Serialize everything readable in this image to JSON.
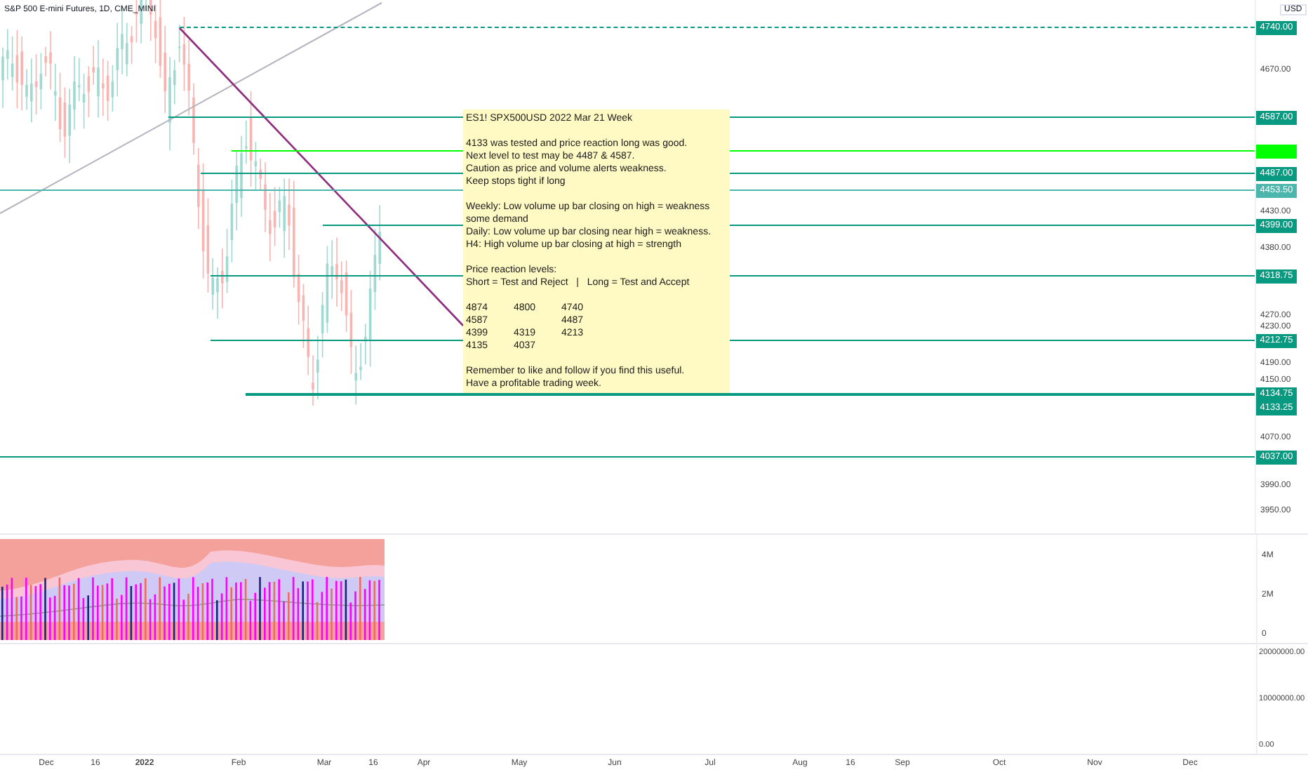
{
  "chart": {
    "title": "S&P 500 E-mini Futures, 1D, CME_MINI",
    "currency": "USD",
    "price_ticks": [
      "4670.00",
      "4430.00",
      "4380.00",
      "4270.00",
      "4230.00",
      "4190.00",
      "4150.00",
      "4070.00",
      "3990.00",
      "3950.00"
    ],
    "levels": [
      {
        "label": "4740.00",
        "color": "#089981",
        "dashed": true
      },
      {
        "label": "4587.00",
        "color": "#089981",
        "dashed": false
      },
      {
        "color": "#00ff00",
        "dashed": false
      },
      {
        "label": "4487.00",
        "color": "#089981",
        "dashed": false
      },
      {
        "label": "4453.50",
        "color": "#4db6ac",
        "dashed": false,
        "kind": "current"
      },
      {
        "label": "4399.00",
        "color": "#089981",
        "dashed": false
      },
      {
        "label": "4318.75",
        "color": "#089981",
        "dashed": false
      },
      {
        "label": "4212.75",
        "color": "#089981",
        "dashed": false
      },
      {
        "label": "4134.75",
        "color": "#089981",
        "dashed": false
      },
      {
        "label": "4133.25",
        "color": "#089981",
        "kind": "badge"
      },
      {
        "label": "4037.00",
        "color": "#089981",
        "dashed": false
      }
    ]
  },
  "note": {
    "title": "ES1! SPX500USD 2022 Mar 21 Week",
    "sections": [
      {
        "kind": "text",
        "lines": [
          "4133 was tested and price reaction long was good.",
          "Next level to test may be 4487 & 4587.",
          "Caution as price and volume alerts weakness.",
          "Keep stops tight if long"
        ]
      },
      {
        "kind": "text",
        "lines": [
          "Weekly: Low volume up bar closing on high = weakness",
          "some demand",
          "Daily: Low volume up bar closing near high = weakness.",
          "H4: High volume up bar closing at high = strength"
        ]
      },
      {
        "kind": "levels",
        "heading": "Price reaction levels:",
        "header": "Short = Test and Reject   |   Long = Test and Accept",
        "rows": [
          {
            "column_1": "4874",
            "column_2": "4800",
            "column_3": "4740"
          },
          {
            "column_1": "4587",
            "column_3": "4487"
          },
          {
            "column_1": "4399",
            "column_2": "4319",
            "column_3": "4213"
          },
          {
            "column_1": "4135",
            "column_2": "4037"
          }
        ]
      },
      {
        "kind": "text",
        "lines": [
          "Remember to like and follow if you find this useful.",
          "Have a profitable trading week."
        ]
      }
    ]
  },
  "volume_pane": {
    "ticks": [
      "4M",
      "2M",
      "0"
    ]
  },
  "indicator_pane": {
    "ticks": [
      "20000000.00",
      "10000000.00",
      "0.00"
    ]
  },
  "time_axis": [
    {
      "label": "Dec"
    },
    {
      "label": "16"
    },
    {
      "label": "2022",
      "kind": "year"
    },
    {
      "label": "Feb"
    },
    {
      "label": "Mar"
    },
    {
      "label": "16"
    },
    {
      "label": "Apr"
    },
    {
      "label": "May"
    },
    {
      "label": "Jun"
    },
    {
      "label": "Jul"
    },
    {
      "label": "Aug"
    },
    {
      "label": "16"
    },
    {
      "label": "Sep"
    },
    {
      "label": "Oct"
    },
    {
      "label": "Nov"
    },
    {
      "label": "Dec"
    }
  ]
}
